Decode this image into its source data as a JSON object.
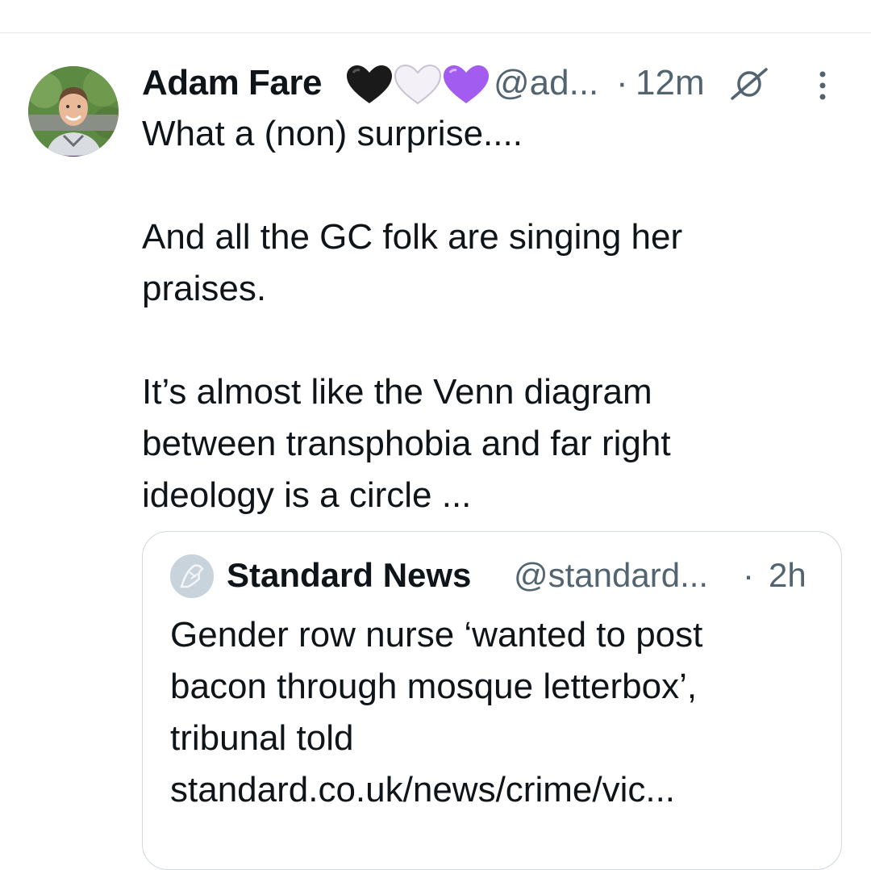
{
  "tweet": {
    "author_name": "Adam Fare",
    "author_emojis": [
      "black-heart-icon",
      "white-heart-icon",
      "purple-heart-icon"
    ],
    "author_handle": "@ad...",
    "separator": "·",
    "time": "12m",
    "paragraphs": [
      "What a (non) surprise....",
      "And all the GC folk are singing her praises.",
      "It’s almost like the Venn diagram between transphobia and far right ideology is a circle ..."
    ]
  },
  "quote": {
    "author_name": "Standard News",
    "author_handle": "@standard...",
    "separator": "·",
    "time": "2h",
    "text": "Gender row nurse ‘wanted to post bacon through mosque letterbox’, tribunal told standard.co.uk/news/crime/vic..."
  },
  "colors": {
    "text": "#0f1419",
    "secondary": "#536471",
    "border": "#cfd9de",
    "heart_black": "#1a1a1a",
    "heart_white": "#f3f0f7",
    "heart_purple": "#a25cf0"
  }
}
